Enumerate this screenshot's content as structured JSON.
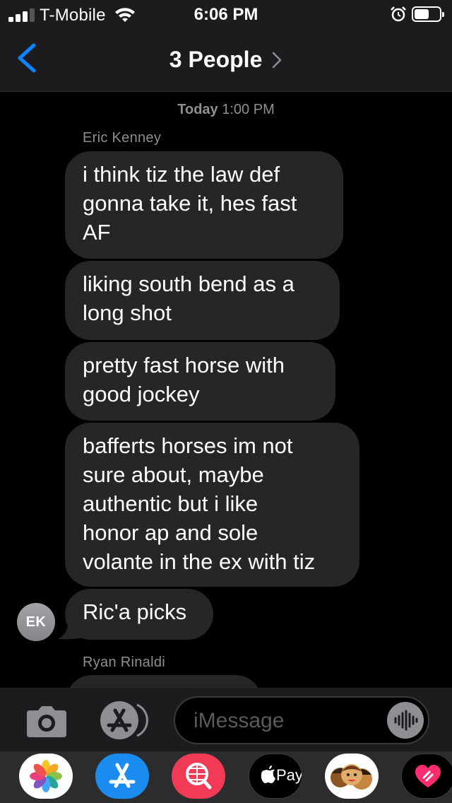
{
  "status_bar": {
    "carrier": "T-Mobile",
    "time": "6:06 PM",
    "signal_bars": 3,
    "battery_level": 0.6
  },
  "nav": {
    "title": "3 People"
  },
  "conversation": {
    "timestamp_day": "Today",
    "timestamp_time": "1:00 PM",
    "sender_1": "Eric Kenney",
    "messages": [
      {
        "lines": [
          "i think tiz the law def",
          "gonna take it, hes fast",
          "AF"
        ]
      },
      {
        "lines": [
          "liking south bend as a",
          "long shot"
        ]
      },
      {
        "lines": [
          "pretty fast horse with",
          "good jockey"
        ]
      },
      {
        "lines": [
          "bafferts horses im not",
          "sure about, maybe",
          "authentic but i like",
          "honor ap and sole",
          "volante in the ex with tiz"
        ]
      },
      {
        "lines": [
          "Ric'a picks"
        ]
      }
    ],
    "avatar_initials": "EK",
    "sender_2": "Ryan Rinaldi"
  },
  "input": {
    "placeholder": "iMessage"
  },
  "app_drawer": {
    "apple_pay_label": "Pay",
    "apps": [
      "photos-icon",
      "app-store-icon",
      "web-images-icon",
      "apple-pay-icon",
      "memoji-icon",
      "digital-touch-icon"
    ]
  },
  "colors": {
    "accent": "#0a84ff",
    "bubble": "#262628",
    "bar": "#1c1c1e"
  }
}
